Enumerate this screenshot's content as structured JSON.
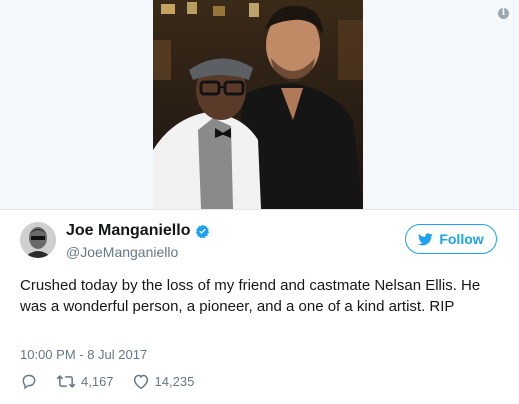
{
  "tweet": {
    "author_name": "Joe Manganiello",
    "author_handle": "@JoeManganiello",
    "follow_label": "Follow",
    "text": "Crushed today by the loss of my friend and castmate Nelsan Ellis. He was a wonderful person, a pioneer, and a one of a kind artist. RIP",
    "timestamp": "10:00 PM - 8 Jul 2017",
    "retweet_count": "4,167",
    "like_count": "14,235",
    "verified": true
  },
  "icons": {
    "info": "info-icon",
    "verified": "verified-badge-icon",
    "follow": "twitter-bird-icon",
    "reply": "reply-icon",
    "retweet": "retweet-icon",
    "like": "heart-icon"
  },
  "colors": {
    "accent": "#1da1f2",
    "text": "#14171a",
    "secondary_text": "#657786",
    "divider": "#e1e8ed"
  }
}
